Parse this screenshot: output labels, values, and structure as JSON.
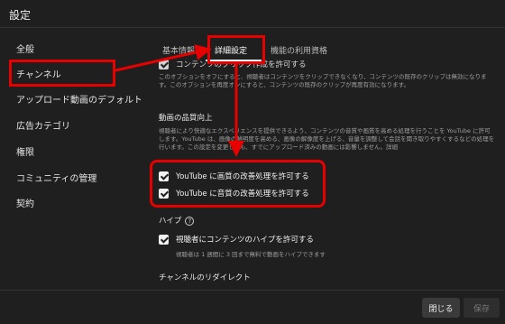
{
  "window": {
    "title": "設定"
  },
  "sidebar": {
    "items": [
      {
        "label": "全般"
      },
      {
        "label": "チャンネル"
      },
      {
        "label": "アップロード動画のデフォルト設定"
      },
      {
        "label": "広告カテゴリ"
      },
      {
        "label": "権限"
      },
      {
        "label": "コミュニティの管理"
      },
      {
        "label": "契約"
      }
    ]
  },
  "tabs": [
    {
      "label": "基本情報"
    },
    {
      "label": "詳細設定"
    },
    {
      "label": "機能の利用資格"
    }
  ],
  "content": {
    "top_cut_line": "コンテンツのクリップ作成を許可する",
    "clip_desc": "このオプションをオフにすると、視聴者はコンテンツをクリップできなくなり、コンテンツの既存のクリップは無効になります。このオプションを再度オンにすると、コンテンツの既存のクリップが再度有効になります。",
    "quality_title": "動画の品質向上",
    "quality_desc": "視聴者により快適なエクスペリエンスを提供できるよう、コンテンツの音質や画質を高める処理を行うことを YouTube に許可します。YouTube は、画像の鮮明度を高める、画像の解像度を上げる、音量を調整して会話を聞き取りやすくするなどの処理を行います。この設定を変更しても、すでにアップロード済みの動画には影響しません。詳細",
    "video_quality_label": "YouTube に画質の改善処理を許可する",
    "audio_quality_label": "YouTube に音質の改善処理を許可する",
    "hype_title": "ハイプ",
    "hype_help": "?",
    "hype_label": "視聴者にコンテンツのハイプを許可する",
    "hype_desc": "視聴者は 1 週間に 3 回まで無料で動画をハイプできます",
    "redirect_title": "チャンネルのリダイレクト"
  },
  "footer": {
    "close_label": "閉じる",
    "save_label": "保存"
  },
  "colors": {
    "annotation": "#e60000",
    "background": "#1f1f1f"
  }
}
